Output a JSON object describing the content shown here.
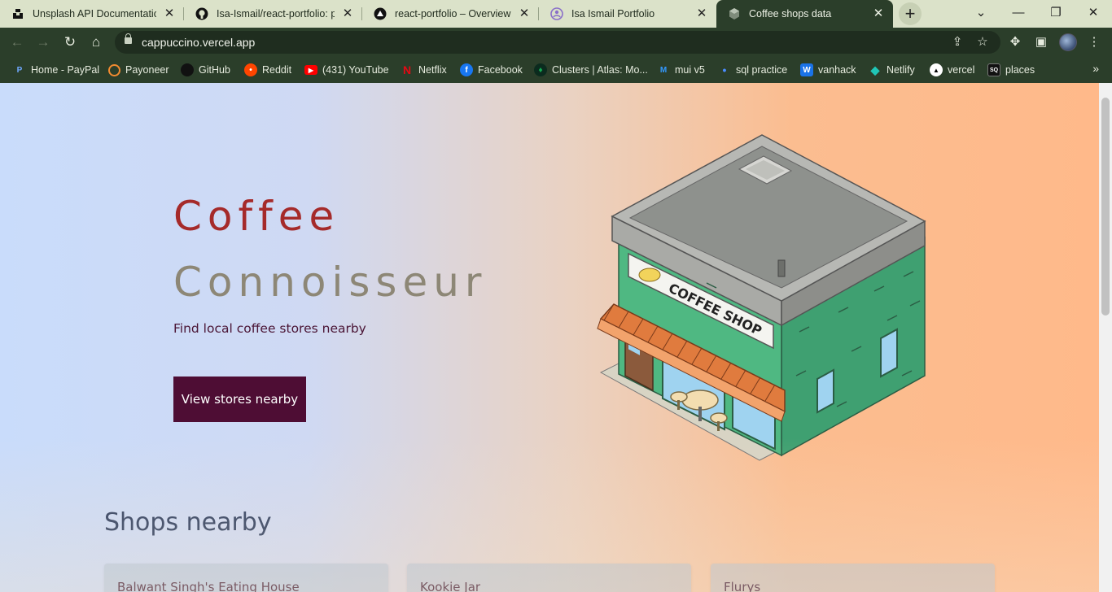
{
  "browser": {
    "tabs": [
      {
        "title": "Unsplash API Documentation",
        "icon": "unsplash-icon"
      },
      {
        "title": "Isa-Ismail/react-portfolio: po",
        "icon": "github-icon"
      },
      {
        "title": "react-portfolio – Overview – V",
        "icon": "vercel-icon"
      },
      {
        "title": "Isa Ismail Portfolio",
        "icon": "portfolio-icon"
      },
      {
        "title": "Coffee shops data",
        "icon": "cube-icon",
        "active": true
      }
    ],
    "address": "cappuccino.vercel.app",
    "bookmarks": [
      {
        "label": "Home - PayPal",
        "icon": "paypal-icon",
        "color": "#253b80"
      },
      {
        "label": "Payoneer",
        "icon": "payoneer-icon",
        "color": "#ff4800"
      },
      {
        "label": "GitHub",
        "icon": "github-icon",
        "color": "#111111"
      },
      {
        "label": "Reddit",
        "icon": "reddit-icon",
        "color": "#ff4500"
      },
      {
        "label": "(431) YouTube",
        "icon": "youtube-icon",
        "color": "#ff0000"
      },
      {
        "label": "Netflix",
        "icon": "netflix-icon",
        "color": "#e50914"
      },
      {
        "label": "Facebook",
        "icon": "facebook-icon",
        "color": "#1877f2"
      },
      {
        "label": "Clusters | Atlas: Mo...",
        "icon": "mongodb-icon",
        "color": "#13aa52"
      },
      {
        "label": "mui v5",
        "icon": "mui-icon",
        "color": "#007fff"
      },
      {
        "label": "sql practice",
        "icon": "dot-icon",
        "color": "#1a73e8"
      },
      {
        "label": "vanhack",
        "icon": "vanhack-icon",
        "color": "#1a73e8"
      },
      {
        "label": "Netlify",
        "icon": "netlify-icon",
        "color": "#20c6b7"
      },
      {
        "label": "vercel",
        "icon": "vercel-icon",
        "color": "#000000"
      },
      {
        "label": "places",
        "icon": "places-icon",
        "color": "#000000"
      }
    ]
  },
  "hero": {
    "title_line1": "Coffee",
    "title_line2": "Connoisseur",
    "subtitle": "Find local coffee stores nearby",
    "button_label": "View stores nearby",
    "illustration_sign": "COFFEE SHOP"
  },
  "shops": {
    "heading": "Shops nearby",
    "items": [
      {
        "name": "Balwant Singh's Eating House"
      },
      {
        "name": "Kookie Jar"
      },
      {
        "name": "Flurys"
      }
    ]
  }
}
